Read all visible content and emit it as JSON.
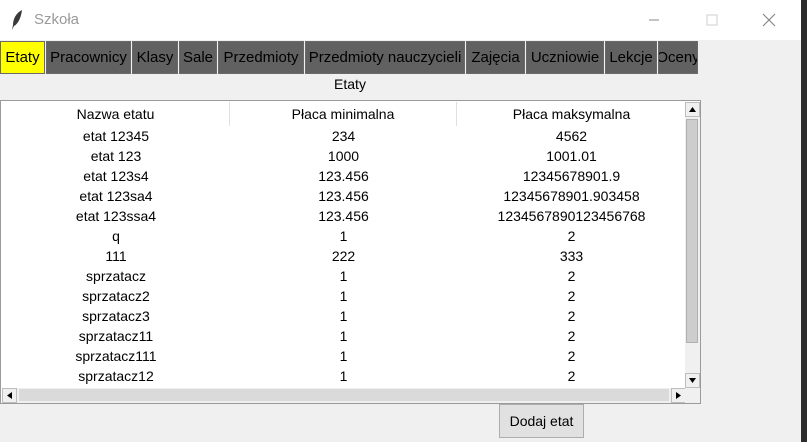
{
  "window": {
    "title": "Szkoła",
    "icon": "feather-icon",
    "controls": [
      "minimize-icon",
      "maximize-icon",
      "close-icon"
    ]
  },
  "tabs": [
    {
      "label": "Etaty",
      "active": true
    },
    {
      "label": "Pracownicy",
      "active": false
    },
    {
      "label": "Klasy",
      "active": false
    },
    {
      "label": "Sale",
      "active": false
    },
    {
      "label": "Przedmioty",
      "active": false
    },
    {
      "label": "Przedmioty nauczycieli",
      "active": false
    },
    {
      "label": "Zajęcia",
      "active": false
    },
    {
      "label": "Uczniowie",
      "active": false
    },
    {
      "label": "Lekcje",
      "active": false
    },
    {
      "label": "Oceny",
      "active": false
    }
  ],
  "colors": {
    "active_tab": "#ffff00",
    "inactive_tab": "#616161"
  },
  "section_label": "Etaty",
  "table": {
    "columns": [
      "Nazwa etatu",
      "Płaca minimalna",
      "Płaca maksymalna"
    ],
    "rows": [
      [
        "etat 12345",
        "234",
        "4562"
      ],
      [
        "etat 123",
        "1000",
        "1001.01"
      ],
      [
        "etat 123s4",
        "123.456",
        "12345678901.9"
      ],
      [
        "etat 123sa4",
        "123.456",
        "12345678901.903458"
      ],
      [
        "etat 123ssa4",
        "123.456",
        "1234567890123456768"
      ],
      [
        "q",
        "1",
        "2"
      ],
      [
        "111",
        "222",
        "333"
      ],
      [
        "sprzatacz",
        "1",
        "2"
      ],
      [
        "sprzatacz2",
        "1",
        "2"
      ],
      [
        "sprzatacz3",
        "1",
        "2"
      ],
      [
        "sprzatacz11",
        "1",
        "2"
      ],
      [
        "sprzatacz111",
        "1",
        "2"
      ],
      [
        "sprzatacz12",
        "1",
        "2"
      ]
    ]
  },
  "add_button": {
    "label": "Dodaj etat"
  }
}
